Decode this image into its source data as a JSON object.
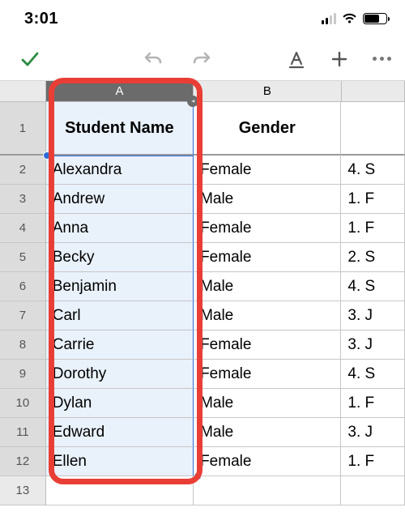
{
  "status": {
    "time": "3:01"
  },
  "columns": {
    "A": "A",
    "B": "B"
  },
  "header_row": {
    "num": "1",
    "A": "Student Name",
    "B": "Gender"
  },
  "rows": [
    {
      "num": "2",
      "A": "Alexandra",
      "B": "Female",
      "C": "4. S"
    },
    {
      "num": "3",
      "A": "Andrew",
      "B": "Male",
      "C": "1. F"
    },
    {
      "num": "4",
      "A": "Anna",
      "B": "Female",
      "C": "1. F"
    },
    {
      "num": "5",
      "A": "Becky",
      "B": "Female",
      "C": "2. S"
    },
    {
      "num": "6",
      "A": "Benjamin",
      "B": "Male",
      "C": "4. S"
    },
    {
      "num": "7",
      "A": "Carl",
      "B": "Male",
      "C": "3. J"
    },
    {
      "num": "8",
      "A": "Carrie",
      "B": "Female",
      "C": "3. J"
    },
    {
      "num": "9",
      "A": "Dorothy",
      "B": "Female",
      "C": "4. S"
    },
    {
      "num": "10",
      "A": "Dylan",
      "B": "Male",
      "C": "1. F"
    },
    {
      "num": "11",
      "A": "Edward",
      "B": "Male",
      "C": "3. J"
    },
    {
      "num": "12",
      "A": "Ellen",
      "B": "Female",
      "C": "1. F"
    },
    {
      "num": "13",
      "A": "",
      "B": "",
      "C": ""
    }
  ]
}
